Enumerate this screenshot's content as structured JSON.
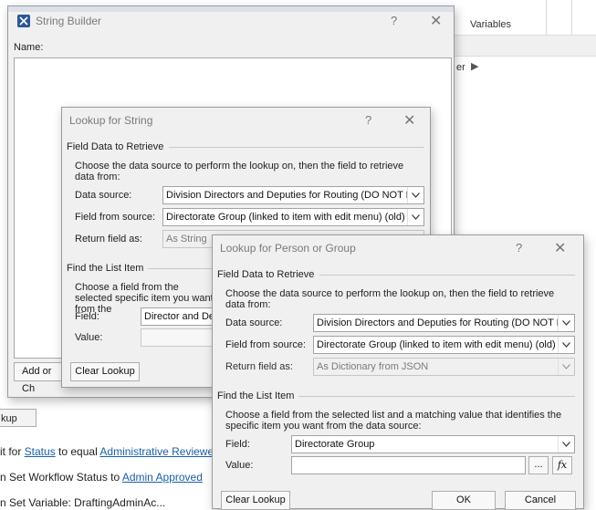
{
  "background": {
    "tab_variables": "Variables",
    "breadcrumb_partial": "er",
    "lookup_button_partial": "kup",
    "step1": {
      "prefix": "it for ",
      "field": "Status",
      "middle": " to equal ",
      "value": "Administrative Reviewer"
    },
    "step2": {
      "prefix": "n Set Workflow Status to ",
      "value": "Admin Approved"
    },
    "step3_partial": "n Set Variable: DraftingAdminAc..."
  },
  "string_builder": {
    "title": "String Builder",
    "help": "?",
    "close": "✕",
    "name_label": "Name:",
    "add_button_partial": "Add or Ch"
  },
  "lookup_string": {
    "title": "Lookup for String",
    "help": "?",
    "close": "✕",
    "section_retrieve": "Field Data to Retrieve",
    "retrieve_description": "Choose the data source to perform the lookup on, then the field to retrieve data from:",
    "data_source_label": "Data source:",
    "data_source_value": "Division Directors and Deputies for Routing (DO NOT DE",
    "field_from_source_label": "Field from source:",
    "field_from_source_value": "Directorate Group (linked to item with edit menu) (old)",
    "return_field_label": "Return field as:",
    "return_field_value": "As String",
    "section_find": "Find the List Item",
    "find_description_partial": "Choose a field from the selected specific item you want from the",
    "field_label": "Field:",
    "field_value_partial": "Director and De",
    "value_label": "Value:",
    "clear_lookup": "Clear Lookup"
  },
  "lookup_person": {
    "title": "Lookup for Person or Group",
    "help": "?",
    "close": "✕",
    "section_retrieve": "Field Data to Retrieve",
    "retrieve_description": "Choose the data source to perform the lookup on, then the field to retrieve data from:",
    "data_source_label": "Data source:",
    "data_source_value": "Division Directors and Deputies for Routing (DO NOT DE",
    "field_from_source_label": "Field from source:",
    "field_from_source_value": "Directorate Group (linked to item with edit menu) (old)",
    "return_field_label": "Return field as:",
    "return_field_value": "As Dictionary from JSON",
    "section_find": "Find the List Item",
    "find_description": "Choose a field from the selected list and a matching value that identifies the specific item you want from the data source:",
    "field_label": "Field:",
    "field_value": "Directorate Group",
    "value_label": "Value:",
    "value_current": "",
    "browse_button": "...",
    "fx_button": "fx",
    "clear_lookup": "Clear Lookup",
    "ok": "OK",
    "cancel": "Cancel"
  },
  "icons": {
    "string_builder_app_icon": "tools-icon",
    "dropdown": "chevron-down-icon"
  },
  "colors": {
    "dialog_bg": "#f0f0f0",
    "title_text": "#7a7a7a",
    "link": "#1a5fa8",
    "app_icon_bg": "#2b5797"
  }
}
